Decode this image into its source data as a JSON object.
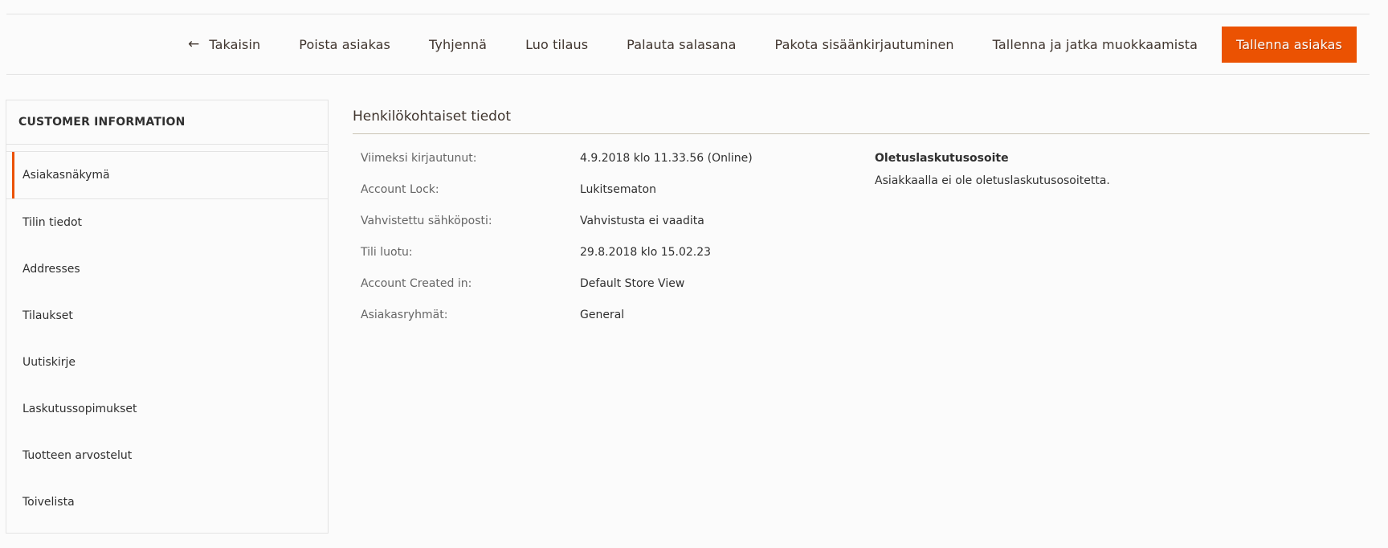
{
  "toolbar": {
    "back_label": "Takaisin",
    "buttons": [
      "Poista asiakas",
      "Tyhjennä",
      "Luo tilaus",
      "Palauta salasana",
      "Pakota sisäänkirjautuminen",
      "Tallenna ja jatka muokkaamista"
    ],
    "primary_label": "Tallenna asiakas",
    "primary_color": "#eb5202"
  },
  "sidebar": {
    "title": "CUSTOMER INFORMATION",
    "items": [
      {
        "label": "Asiakasnäkymä",
        "active": true
      },
      {
        "label": "Tilin tiedot"
      },
      {
        "label": "Addresses"
      },
      {
        "label": "Tilaukset"
      },
      {
        "label": "Uutiskirje"
      },
      {
        "label": "Laskutussopimukset"
      },
      {
        "label": "Tuotteen arvostelut"
      },
      {
        "label": "Toivelista"
      }
    ]
  },
  "main": {
    "section_title": "Henkilökohtaiset tiedot",
    "info": [
      {
        "label": "Viimeksi kirjautunut:",
        "value": "4.9.2018 klo 11.33.56 (Online)"
      },
      {
        "label": "Account Lock:",
        "value": "Lukitsematon"
      },
      {
        "label": "Vahvistettu sähköposti:",
        "value": "Vahvistusta ei vaadita"
      },
      {
        "label": "Tili luotu:",
        "value": "29.8.2018 klo 15.02.23"
      },
      {
        "label": "Account Created in:",
        "value": "Default Store View"
      },
      {
        "label": "Asiakasryhmät:",
        "value": "General"
      }
    ],
    "billing": {
      "title": "Oletuslaskutusosoite",
      "text": "Asiakkaalla ei ole oletuslaskutusosoitetta."
    }
  }
}
